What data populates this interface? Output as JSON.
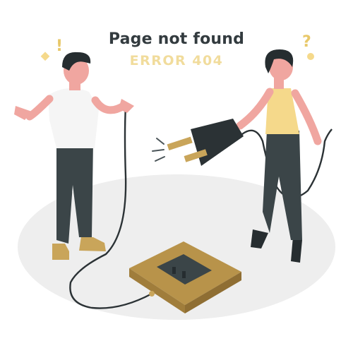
{
  "heading": {
    "title": "Page not found",
    "subtitle": "ERROR 404"
  },
  "marks": {
    "exclamation": "!",
    "question": "?"
  },
  "colors": {
    "title_text": "#333b3f",
    "subtitle_text": "#f1dc9c",
    "accent_gold": "#c9a55a",
    "accent_gold_light": "#e6cf93",
    "pants_dark": "#3b4548",
    "shirt_white": "#f5f5f5",
    "top_yellow": "#f5d98b",
    "skin": "#f0a6a0",
    "hair": "#262d30",
    "floor": "#eeeeee"
  },
  "icons": {
    "plug": "power-plug-icon",
    "socket": "power-socket-icon",
    "sparks": "spark-lines-icon"
  }
}
